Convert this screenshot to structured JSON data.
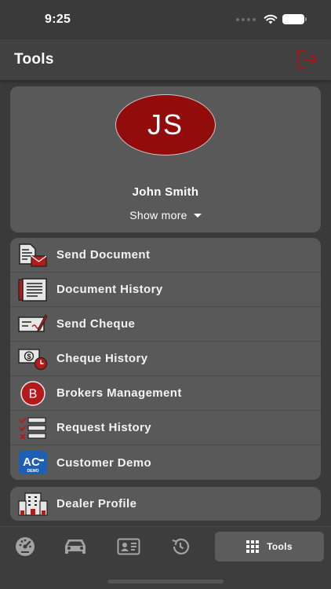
{
  "status_bar": {
    "time": "9:25"
  },
  "header": {
    "title": "Tools"
  },
  "profile": {
    "initials": "JS",
    "name": "John Smith",
    "show_more_label": "Show more"
  },
  "menu": {
    "items": [
      {
        "label": "Send Document",
        "icon": "send-document-icon"
      },
      {
        "label": "Document History",
        "icon": "document-history-icon"
      },
      {
        "label": "Send Cheque",
        "icon": "send-cheque-icon"
      },
      {
        "label": "Cheque History",
        "icon": "cheque-history-icon"
      },
      {
        "label": "Brokers Management",
        "icon": "brokers-management-icon",
        "badge": "B"
      },
      {
        "label": "Request History",
        "icon": "request-history-icon"
      },
      {
        "label": "Customer Demo",
        "icon": "customer-demo-icon",
        "logo_text": "AC",
        "logo_sub": "DEMO"
      }
    ]
  },
  "dealer": {
    "label": "Dealer Profile"
  },
  "tab_bar": {
    "tabs": [
      {
        "icon": "dashboard-icon"
      },
      {
        "icon": "car-icon"
      },
      {
        "icon": "id-card-icon"
      },
      {
        "icon": "history-icon"
      },
      {
        "icon": "grid-icon",
        "label": "Tools",
        "active": true
      }
    ]
  },
  "colors": {
    "accent": "#930c0c",
    "card": "#595959",
    "background": "#3a3a3a"
  }
}
